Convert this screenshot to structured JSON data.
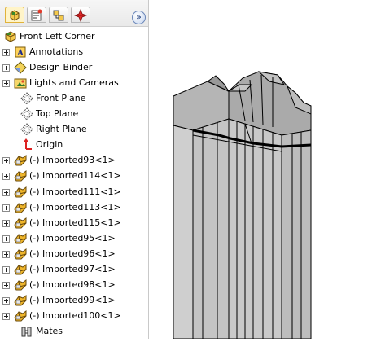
{
  "tabs": [
    {
      "name": "feature-manager",
      "icon": "feature-manager-icon",
      "active": true
    },
    {
      "name": "property-manager",
      "icon": "property-manager-icon",
      "active": false
    },
    {
      "name": "configuration-manager",
      "icon": "configuration-manager-icon",
      "active": false
    },
    {
      "name": "dimxpert-manager",
      "icon": "dimxpert-icon",
      "active": false
    }
  ],
  "tree": {
    "root_label": "Front Left Corner",
    "items": [
      {
        "label": "Annotations",
        "icon": "annotations-icon",
        "expandable": true
      },
      {
        "label": "Design Binder",
        "icon": "design-binder-icon",
        "expandable": true
      },
      {
        "label": "Lights and Cameras",
        "icon": "lights-cameras-icon",
        "expandable": true
      },
      {
        "label": "Front Plane",
        "icon": "plane-icon",
        "expandable": false
      },
      {
        "label": "Top Plane",
        "icon": "plane-icon",
        "expandable": false
      },
      {
        "label": "Right Plane",
        "icon": "plane-icon",
        "expandable": false
      },
      {
        "label": "Origin",
        "icon": "origin-icon",
        "expandable": false
      },
      {
        "label": "(-) Imported93<1>",
        "icon": "part-icon",
        "expandable": true
      },
      {
        "label": "(-) Imported114<1>",
        "icon": "part-icon",
        "expandable": true
      },
      {
        "label": "(-) Imported111<1>",
        "icon": "part-icon",
        "expandable": true
      },
      {
        "label": "(-) Imported113<1>",
        "icon": "part-icon",
        "expandable": true
      },
      {
        "label": "(-) Imported115<1>",
        "icon": "part-icon",
        "expandable": true
      },
      {
        "label": "(-) Imported95<1>",
        "icon": "part-icon",
        "expandable": true
      },
      {
        "label": "(-) Imported96<1>",
        "icon": "part-icon",
        "expandable": true
      },
      {
        "label": "(-) Imported97<1>",
        "icon": "part-icon",
        "expandable": true
      },
      {
        "label": "(-) Imported98<1>",
        "icon": "part-icon",
        "expandable": true
      },
      {
        "label": "(-) Imported99<1>",
        "icon": "part-icon",
        "expandable": true
      },
      {
        "label": "(-) Imported100<1>",
        "icon": "part-icon",
        "expandable": true
      },
      {
        "label": "Mates",
        "icon": "mates-icon",
        "expandable": false
      }
    ]
  },
  "collapse_button": {
    "glyph": "»",
    "icon": "double-chevron-right-icon"
  },
  "colors": {
    "model_face": "#c8c8c8",
    "model_top": "#a8a8a8",
    "model_edge": "#000000",
    "tab_active": "#fff4c8"
  }
}
